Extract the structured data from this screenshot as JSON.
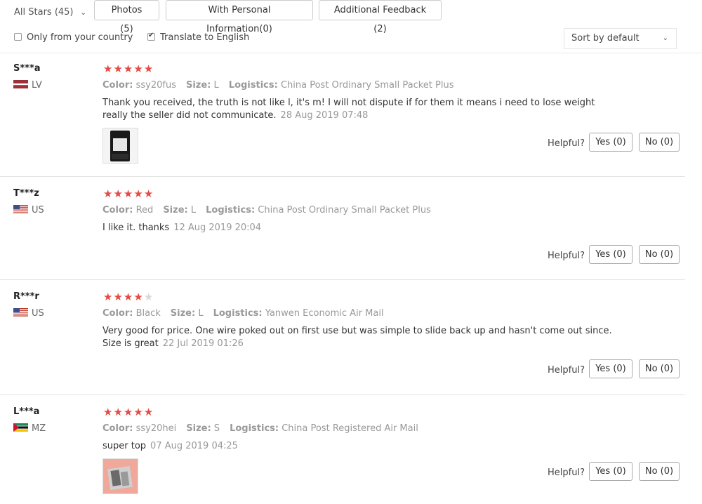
{
  "filters": {
    "stars_select": "All Stars (45)",
    "photos": "Photos (5)",
    "personal": "With Personal Information(0)",
    "additional": "Additional Feedback (2)",
    "only_country": "Only from your country",
    "only_country_checked": false,
    "translate": "Translate to English",
    "translate_checked": true,
    "sort": "Sort by default"
  },
  "labels": {
    "color": "Color:",
    "size": "Size:",
    "logistics": "Logistics:",
    "helpful": "Helpful?"
  },
  "reviews": [
    {
      "user": "S***a",
      "country": "LV",
      "flag": "latvia",
      "rating": 5,
      "color": "ssy20fus",
      "size": "L",
      "logistics": "China Post Ordinary Small Packet Plus",
      "text": "Thank you received, the truth is not like l, it's m! I will not dispute if for them it means i need to lose weight really the seller did not communicate.",
      "date": "28 Aug 2019 07:48",
      "has_photo": true,
      "yes": "Yes (0)",
      "no": "No (0)"
    },
    {
      "user": "T***z",
      "country": "US",
      "flag": "usa",
      "rating": 5,
      "color": "Red",
      "size": "L",
      "logistics": "China Post Ordinary Small Packet Plus",
      "text": "I like it. thanks",
      "date": "12 Aug 2019 20:04",
      "has_photo": false,
      "yes": "Yes (0)",
      "no": "No (0)"
    },
    {
      "user": "R***r",
      "country": "US",
      "flag": "usa",
      "rating": 4,
      "color": "Black",
      "size": "L",
      "logistics": "Yanwen Economic Air Mail",
      "text": "Very good for price. One wire poked out on first use but was simple to slide back up and hasn't come out since. Size is great",
      "date": "22 Jul 2019 01:26",
      "has_photo": false,
      "yes": "Yes (0)",
      "no": "No (0)"
    },
    {
      "user": "L***a",
      "country": "MZ",
      "flag": "mozambique",
      "rating": 5,
      "color": "ssy20hei",
      "size": "S",
      "logistics": "China Post Registered Air Mail",
      "text": "super top",
      "date": "07 Aug 2019 04:25",
      "has_photo": true,
      "yes": "Yes (0)",
      "no": "No (0)"
    }
  ]
}
